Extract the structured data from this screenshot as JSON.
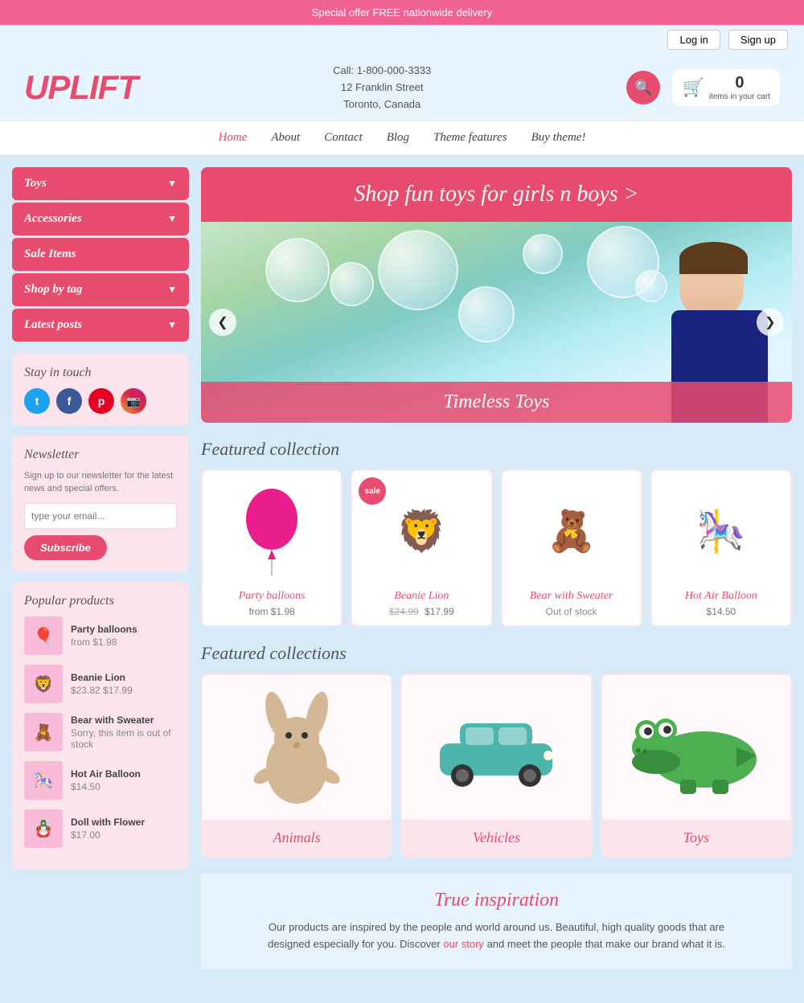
{
  "top_banner": {
    "text": "Special offer FREE nationwide delivery"
  },
  "auth": {
    "login": "Log in",
    "signup": "Sign up"
  },
  "header": {
    "logo": "UPLIFT",
    "phone": "Call: 1-800-000-3333",
    "address": "12 Franklin Street",
    "city": "Toronto, Canada",
    "cart_count": "0",
    "cart_label": "items in your cart"
  },
  "nav": {
    "items": [
      {
        "label": "Home",
        "active": true
      },
      {
        "label": "About",
        "active": false
      },
      {
        "label": "Contact",
        "active": false
      },
      {
        "label": "Blog",
        "active": false
      },
      {
        "label": "Theme features",
        "active": false
      },
      {
        "label": "Buy theme!",
        "active": false
      }
    ]
  },
  "sidebar": {
    "menu": [
      {
        "label": "Toys",
        "has_arrow": true
      },
      {
        "label": "Accessories",
        "has_arrow": true
      },
      {
        "label": "Sale Items",
        "has_arrow": false
      },
      {
        "label": "Shop by tag",
        "has_arrow": true
      },
      {
        "label": "Latest posts",
        "has_arrow": true
      }
    ],
    "stay_in_touch": {
      "title": "Stay in touch",
      "socials": [
        {
          "name": "twitter",
          "symbol": "t"
        },
        {
          "name": "facebook",
          "symbol": "f"
        },
        {
          "name": "pinterest",
          "symbol": "p"
        },
        {
          "name": "instagram",
          "symbol": "i"
        }
      ]
    },
    "newsletter": {
      "title": "Newsletter",
      "desc": "Sign up to our newsletter for the latest news and special offers.",
      "placeholder": "type your email...",
      "button": "Subscribe"
    },
    "popular_products": {
      "title": "Popular products",
      "items": [
        {
          "name": "Party balloons",
          "price": "from $1.98",
          "emoji": "🎈"
        },
        {
          "name": "Beanie Lion",
          "price_old": "$23.82",
          "price": "$17.99",
          "emoji": "🦁"
        },
        {
          "name": "Bear with Sweater",
          "status": "Sorry, this item is out of stock",
          "emoji": "🧸"
        },
        {
          "name": "Hot Air Balloon",
          "price": "$14.50",
          "emoji": "🎠"
        },
        {
          "name": "Doll with Flower",
          "price": "$17.00",
          "emoji": "🪆"
        }
      ]
    }
  },
  "hero": {
    "cta": "Shop fun toys for girls n boys >",
    "slider_label": "Timeless Toys",
    "btn_prev": "❮",
    "btn_next": "❯"
  },
  "featured_collection": {
    "title": "Featured collection",
    "products": [
      {
        "name": "Party balloons",
        "price": "from $1.98",
        "emoji": "🎈",
        "sale": false
      },
      {
        "name": "Beanie Lion",
        "price": "$17.99",
        "price_old": "$24.99",
        "emoji": "🦁",
        "sale": true
      },
      {
        "name": "Bear with Sweater",
        "status": "Out of stock",
        "emoji": "🧸",
        "sale": false
      },
      {
        "name": "Hot Air Balloon",
        "price": "$14.50",
        "emoji": "🎠",
        "sale": false
      }
    ],
    "sale_badge": "sale"
  },
  "featured_collections": {
    "title": "Featured collections",
    "items": [
      {
        "label": "Animals",
        "emoji": "🐰"
      },
      {
        "label": "Vehicles",
        "emoji": "🚗"
      },
      {
        "label": "Toys",
        "emoji": "🐊"
      }
    ]
  },
  "inspiration": {
    "title": "True inspiration",
    "text": "Our products are inspired by the people and world around us. Beautiful, high quality goods that are designed especially for you. Discover",
    "link_text": "our story",
    "text2": "and meet the people that make our brand what it is."
  }
}
